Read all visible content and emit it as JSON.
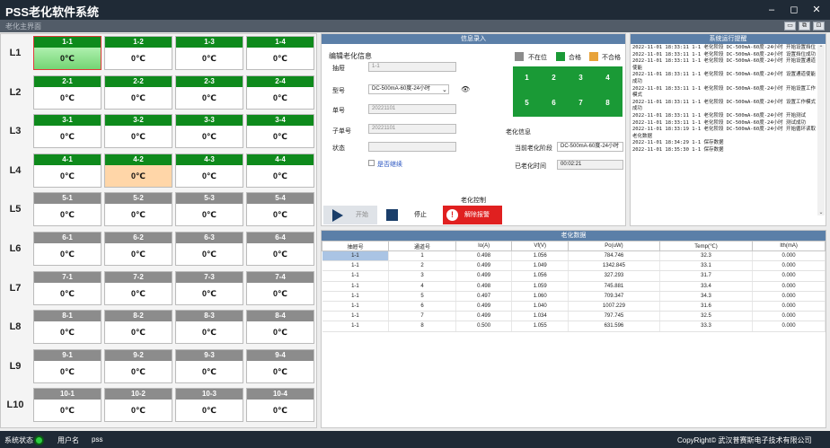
{
  "window": {
    "title": "PSS老化软件系统",
    "subtitle": "老化主界面",
    "min": "–",
    "restore": "◻",
    "close": "✕",
    "sub_btns": [
      "▭",
      "⧉",
      "⊡"
    ]
  },
  "slots": {
    "rows": [
      "L1",
      "L2",
      "L3",
      "L4",
      "L5",
      "L6",
      "L7",
      "L8",
      "L9",
      "L10"
    ],
    "grid": [
      [
        {
          "id": "1-1",
          "temp": "0℃",
          "state": "green"
        },
        {
          "id": "1-2",
          "temp": "0℃",
          "state": "green"
        },
        {
          "id": "1-3",
          "temp": "0℃",
          "state": "green"
        },
        {
          "id": "1-4",
          "temp": "0℃",
          "state": "green"
        }
      ],
      [
        {
          "id": "2-1",
          "temp": "0℃",
          "state": "green"
        },
        {
          "id": "2-2",
          "temp": "0℃",
          "state": "green"
        },
        {
          "id": "2-3",
          "temp": "0℃",
          "state": "green"
        },
        {
          "id": "2-4",
          "temp": "0℃",
          "state": "green"
        }
      ],
      [
        {
          "id": "3-1",
          "temp": "0℃",
          "state": "green"
        },
        {
          "id": "3-2",
          "temp": "0℃",
          "state": "green"
        },
        {
          "id": "3-3",
          "temp": "0℃",
          "state": "green"
        },
        {
          "id": "3-4",
          "temp": "0℃",
          "state": "green"
        }
      ],
      [
        {
          "id": "4-1",
          "temp": "0℃",
          "state": "green"
        },
        {
          "id": "4-2",
          "temp": "0℃",
          "state": "green"
        },
        {
          "id": "4-3",
          "temp": "0℃",
          "state": "green"
        },
        {
          "id": "4-4",
          "temp": "0℃",
          "state": "green"
        }
      ],
      [
        {
          "id": "5-1",
          "temp": "0℃",
          "state": "gray"
        },
        {
          "id": "5-2",
          "temp": "0℃",
          "state": "gray"
        },
        {
          "id": "5-3",
          "temp": "0℃",
          "state": "gray"
        },
        {
          "id": "5-4",
          "temp": "0℃",
          "state": "gray"
        }
      ],
      [
        {
          "id": "6-1",
          "temp": "0℃",
          "state": "gray"
        },
        {
          "id": "6-2",
          "temp": "0℃",
          "state": "gray"
        },
        {
          "id": "6-3",
          "temp": "0℃",
          "state": "gray"
        },
        {
          "id": "6-4",
          "temp": "0℃",
          "state": "gray"
        }
      ],
      [
        {
          "id": "7-1",
          "temp": "0℃",
          "state": "gray"
        },
        {
          "id": "7-2",
          "temp": "0℃",
          "state": "gray"
        },
        {
          "id": "7-3",
          "temp": "0℃",
          "state": "gray"
        },
        {
          "id": "7-4",
          "temp": "0℃",
          "state": "gray"
        }
      ],
      [
        {
          "id": "8-1",
          "temp": "0℃",
          "state": "gray"
        },
        {
          "id": "8-2",
          "temp": "0℃",
          "state": "gray"
        },
        {
          "id": "8-3",
          "temp": "0℃",
          "state": "gray"
        },
        {
          "id": "8-4",
          "temp": "0℃",
          "state": "gray"
        }
      ],
      [
        {
          "id": "9-1",
          "temp": "0℃",
          "state": "gray"
        },
        {
          "id": "9-2",
          "temp": "0℃",
          "state": "gray"
        },
        {
          "id": "9-3",
          "temp": "0℃",
          "state": "gray"
        },
        {
          "id": "9-4",
          "temp": "0℃",
          "state": "gray"
        }
      ],
      [
        {
          "id": "10-1",
          "temp": "0℃",
          "state": "gray"
        },
        {
          "id": "10-2",
          "temp": "0℃",
          "state": "gray"
        },
        {
          "id": "10-3",
          "temp": "0℃",
          "state": "gray"
        },
        {
          "id": "10-4",
          "temp": "0℃",
          "state": "gray"
        }
      ]
    ]
  },
  "info": {
    "header": "信息录入",
    "edit_title": "编辑老化信息",
    "layer_label": "抽屉",
    "layer_value": "1-1",
    "model_label": "型号",
    "model_value": "DC-500mA-60度-24小时",
    "order_label": "单号",
    "order_value": "20221101",
    "suborder_label": "子单号",
    "suborder_value": "20221101",
    "status_label": "状态",
    "status_value": "",
    "continue_label": "是否继续",
    "legend": [
      {
        "label": "不在位",
        "color": "#8c8c8c"
      },
      {
        "label": "合格",
        "color": "#1a9a36"
      },
      {
        "label": "不合格",
        "color": "#e8a33a"
      }
    ],
    "channels": [
      "1",
      "2",
      "3",
      "4",
      "5",
      "6",
      "7",
      "8"
    ],
    "aging_title": "老化信息",
    "stage_label": "当前老化阶段",
    "stage_value": "DC-500mA-60度-24小时",
    "elapsed_label": "已老化时间",
    "elapsed_value": "00:02:21",
    "control_title": "老化控制",
    "start_label": "开始",
    "stop_label": "停止",
    "alarm_label": "解除报警"
  },
  "log": {
    "header": "系统运行提醒",
    "lines": [
      "2022-11-01 18:33:11 1-1 老化阶段 DC-500mA-60度-24小时 开始设置挡位",
      "2022-11-01 18:33:11 1-1 老化阶段 DC-500mA-60度-24小时 设置挡位成功",
      "2022-11-01 18:33:11 1-1 老化阶段 DC-500mA-60度-24小时 开始设置通道使能",
      "2022-11-01 18:33:11 1-1 老化阶段 DC-500mA-60度-24小时 设置通道使能成功",
      "2022-11-01 18:33:11 1-1 老化阶段 DC-500mA-60度-24小时 开始设置工作模式",
      "2022-11-01 18:33:11 1-1 老化阶段 DC-500mA-60度-24小时 设置工作模式成功",
      "2022-11-01 18:33:11 1-1 老化阶段 DC-500mA-60度-24小时 开始测试",
      "2022-11-01 18:33:11 1-1 老化阶段 DC-500mA-60度-24小时 测试成功",
      "2022-11-01 18:33:19 1-1 老化阶段 DC-500mA-60度-24小时 开始循环读取老化数据",
      "2022-11-01 18:34:29 1-1 保存数据",
      "2022-11-01 18:35:30 1-1 保存数据"
    ]
  },
  "table": {
    "header": "老化数据",
    "columns": [
      "抽屉号",
      "通道号",
      "Io(A)",
      "Vf(V)",
      "Po(uW)",
      "Temp(℃)",
      "Ith(mA)"
    ],
    "rows": [
      [
        "1-1",
        "1",
        "0.498",
        "1.056",
        "784.746",
        "32.3",
        "0.000"
      ],
      [
        "1-1",
        "2",
        "0.499",
        "1.049",
        "1342.845",
        "33.1",
        "0.000"
      ],
      [
        "1-1",
        "3",
        "0.499",
        "1.056",
        "327.293",
        "31.7",
        "0.000"
      ],
      [
        "1-1",
        "4",
        "0.498",
        "1.059",
        "745.881",
        "33.4",
        "0.000"
      ],
      [
        "1-1",
        "5",
        "0.497",
        "1.060",
        "709.347",
        "34.3",
        "0.000"
      ],
      [
        "1-1",
        "6",
        "0.499",
        "1.040",
        "1007.229",
        "31.6",
        "0.000"
      ],
      [
        "1-1",
        "7",
        "0.499",
        "1.034",
        "797.745",
        "32.5",
        "0.000"
      ],
      [
        "1-1",
        "8",
        "0.500",
        "1.055",
        "631.596",
        "33.3",
        "0.000"
      ]
    ]
  },
  "status": {
    "system_label": "系统状态",
    "user_label": "用户名",
    "user_value": "pss",
    "copyright": "CopyRight© 武汉普赛斯电子技术有限公司"
  }
}
